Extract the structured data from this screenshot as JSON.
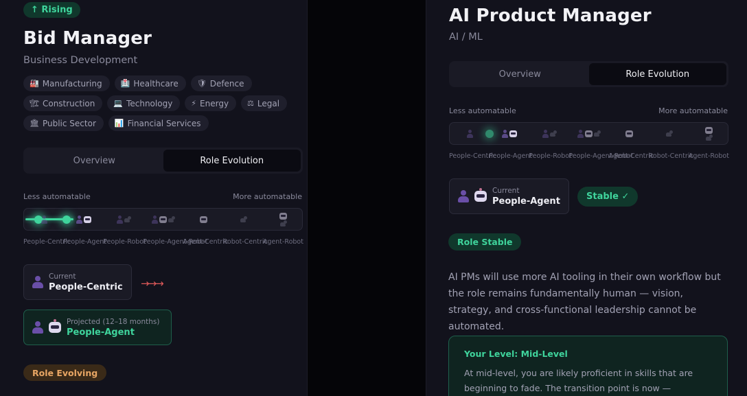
{
  "left": {
    "trend_badge": "↑ Rising",
    "title": "Bid Manager",
    "category": "Business Development",
    "tags": [
      {
        "icon": "factory-icon",
        "glyph": "🏭",
        "label": "Manufacturing"
      },
      {
        "icon": "hospital-icon",
        "glyph": "🏥",
        "label": "Healthcare"
      },
      {
        "icon": "shield-icon",
        "glyph": "🛡",
        "label": "Defence"
      },
      {
        "icon": "construction-icon",
        "glyph": "🏗",
        "label": "Construction"
      },
      {
        "icon": "laptop-icon",
        "glyph": "💻",
        "label": "Technology"
      },
      {
        "icon": "lightning-icon",
        "glyph": "⚡",
        "label": "Energy"
      },
      {
        "icon": "scales-icon",
        "glyph": "⚖",
        "label": "Legal"
      },
      {
        "icon": "government-icon",
        "glyph": "🏛",
        "label": "Public Sector"
      },
      {
        "icon": "chart-icon",
        "glyph": "📊",
        "label": "Financial Services"
      }
    ],
    "tabs": [
      {
        "label": "Overview",
        "active": false
      },
      {
        "label": "Role Evolution",
        "active": true
      }
    ],
    "scale_less": "Less automatable",
    "scale_more": "More automatable",
    "current_label": "Current",
    "current_value": "People-Centric",
    "projected_label": "Projected (12–18 months)",
    "projected_value": "People-Agent",
    "status_badge": "Role Evolving"
  },
  "right": {
    "title": "AI Product Manager",
    "category": "AI / ML",
    "tabs": [
      {
        "label": "Overview",
        "active": false
      },
      {
        "label": "Role Evolution",
        "active": true
      }
    ],
    "scale_less": "Less automatable",
    "scale_more": "More automatable",
    "current_label": "Current",
    "current_value": "People-Agent",
    "stable_badge": "Stable ✓",
    "role_badge": "Role Stable",
    "description": "AI PMs will use more AI tooling in their own workflow but the role remains fundamentally human — vision, strategy, and cross-functional leadership cannot be automated.",
    "level_title": "Your Level: Mid-Level",
    "level_body": "At mid-level, you are likely proficient in skills that are beginning to fade. The transition point is now — developing"
  },
  "scale_segments": [
    "People-Centric",
    "People-Agent",
    "People-Robot",
    "People-Agent-Robot",
    "Agent-Centric",
    "Robot-Centric",
    "Agent-Robot"
  ],
  "colors": {
    "accent_green": "#3fd49c",
    "accent_orange": "#e8a664",
    "arrow_red": "#e05a5a",
    "panel_bg": "#12121c"
  }
}
